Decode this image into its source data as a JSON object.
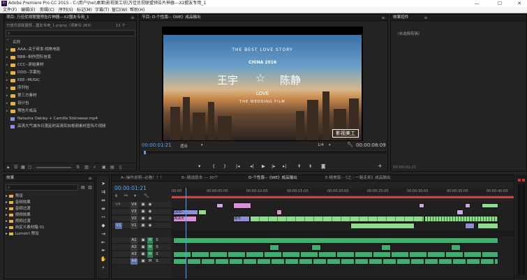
{
  "window": {
    "title": "Adobe Premiere Pro CC 2015 - C:\\用户\\hei\\桌面\\影视美工坊\\万佳优视联盟预告片神器---X2盟友专用_1",
    "controls": [
      "—",
      "☐",
      "✕"
    ]
  },
  "menu": [
    "文件(F)",
    "编辑(E)",
    "剪辑(C)",
    "序列(S)",
    "标记(M)",
    "字幕(T)",
    "窗口(W)",
    "帮助(H)"
  ],
  "project": {
    "tab": "项目: 万佳优视联盟预告片神器---X2盟友专用_1",
    "path": "万佳优视联盟预...盟友专用_1.prproj（项索引 263）",
    "count": "11 个",
    "column": "名称",
    "items": [
      {
        "label": "AAA--关于研发-相角电影",
        "type": "folder"
      },
      {
        "label": "BBB--制作团队信息",
        "type": "folder"
      },
      {
        "label": "CCC--原始素材",
        "type": "folder"
      },
      {
        "label": "DDD--字幕包",
        "type": "folder"
      },
      {
        "label": "EEE--MUSIC",
        "type": "folder"
      },
      {
        "label": "序列包",
        "type": "folder"
      },
      {
        "label": "第三方素材",
        "type": "folder"
      },
      {
        "label": "设计包",
        "type": "folder"
      },
      {
        "label": "预告片成品",
        "type": "folder"
      },
      {
        "label": "Natasha Oakley + Camilla Steinwear.mp4",
        "type": "clip"
      },
      {
        "label": "高清大气城市日落延时高清实拍视频素材宣传片视频",
        "type": "clip"
      }
    ],
    "zoom_icon": "▭"
  },
  "program": {
    "tab": "节目: D-个性版--《WE》成品输出",
    "frame_title": "THE BEST LOVE STORY",
    "frame_year": "CHINA 2016",
    "frame_left_name": "王宇",
    "frame_right_name": "陈静",
    "frame_love": "LOVE",
    "frame_sub": "THE WEDDING FILM",
    "frame_logo": "影视美工",
    "timecode": "00:00:01:21",
    "fit": "适合",
    "quality": "1/4",
    "duration": "00:00:08:09",
    "playback_timecode": "00:00:01:21"
  },
  "effect_controls": {
    "tab": "效果控件",
    "empty": "（未选择剪辑）",
    "timecode": "00:00:01:21"
  },
  "effects": {
    "tab": "效果",
    "items": [
      "预设",
      "音频效果",
      "音频过渡",
      "视频效果",
      "视频过渡",
      "自定义素材箱 01",
      "Lumetri 预设"
    ]
  },
  "timeline": {
    "tabs": [
      "A--操作说明--必看！！！",
      "B--精选版本 --- 30个",
      "D-个性版--《WE》成品输出",
      "E-精美版--《之 - 一路走来》成品输出"
    ],
    "timecode": "00:00:01:21",
    "ruler": [
      "00:00",
      "00:00:05:00",
      "00:00:10:00",
      "00:00:15:00",
      "00:00:20:00",
      "00:00:25:00",
      "00:00:30:00",
      "00:00:35:00",
      "00:00:40:00"
    ],
    "video_tracks": [
      "V4",
      "V3",
      "V2",
      "V1"
    ],
    "audio_tracks": [
      "A1",
      "A2",
      "A3",
      "A4"
    ],
    "clip_labels": {
      "ddd": "DDD--…",
      "highclear": "高清大",
      "city": "城市"
    }
  },
  "colors": {
    "folder": "#e9b340",
    "video_clip": "#8f8fd6",
    "pink_clip": "#d98fd9",
    "green_clip": "#8fdc8f",
    "audio_clip": "#3fae6f",
    "accent_timecode": "#5aa9f0",
    "playhead": "#4ba3ff"
  }
}
